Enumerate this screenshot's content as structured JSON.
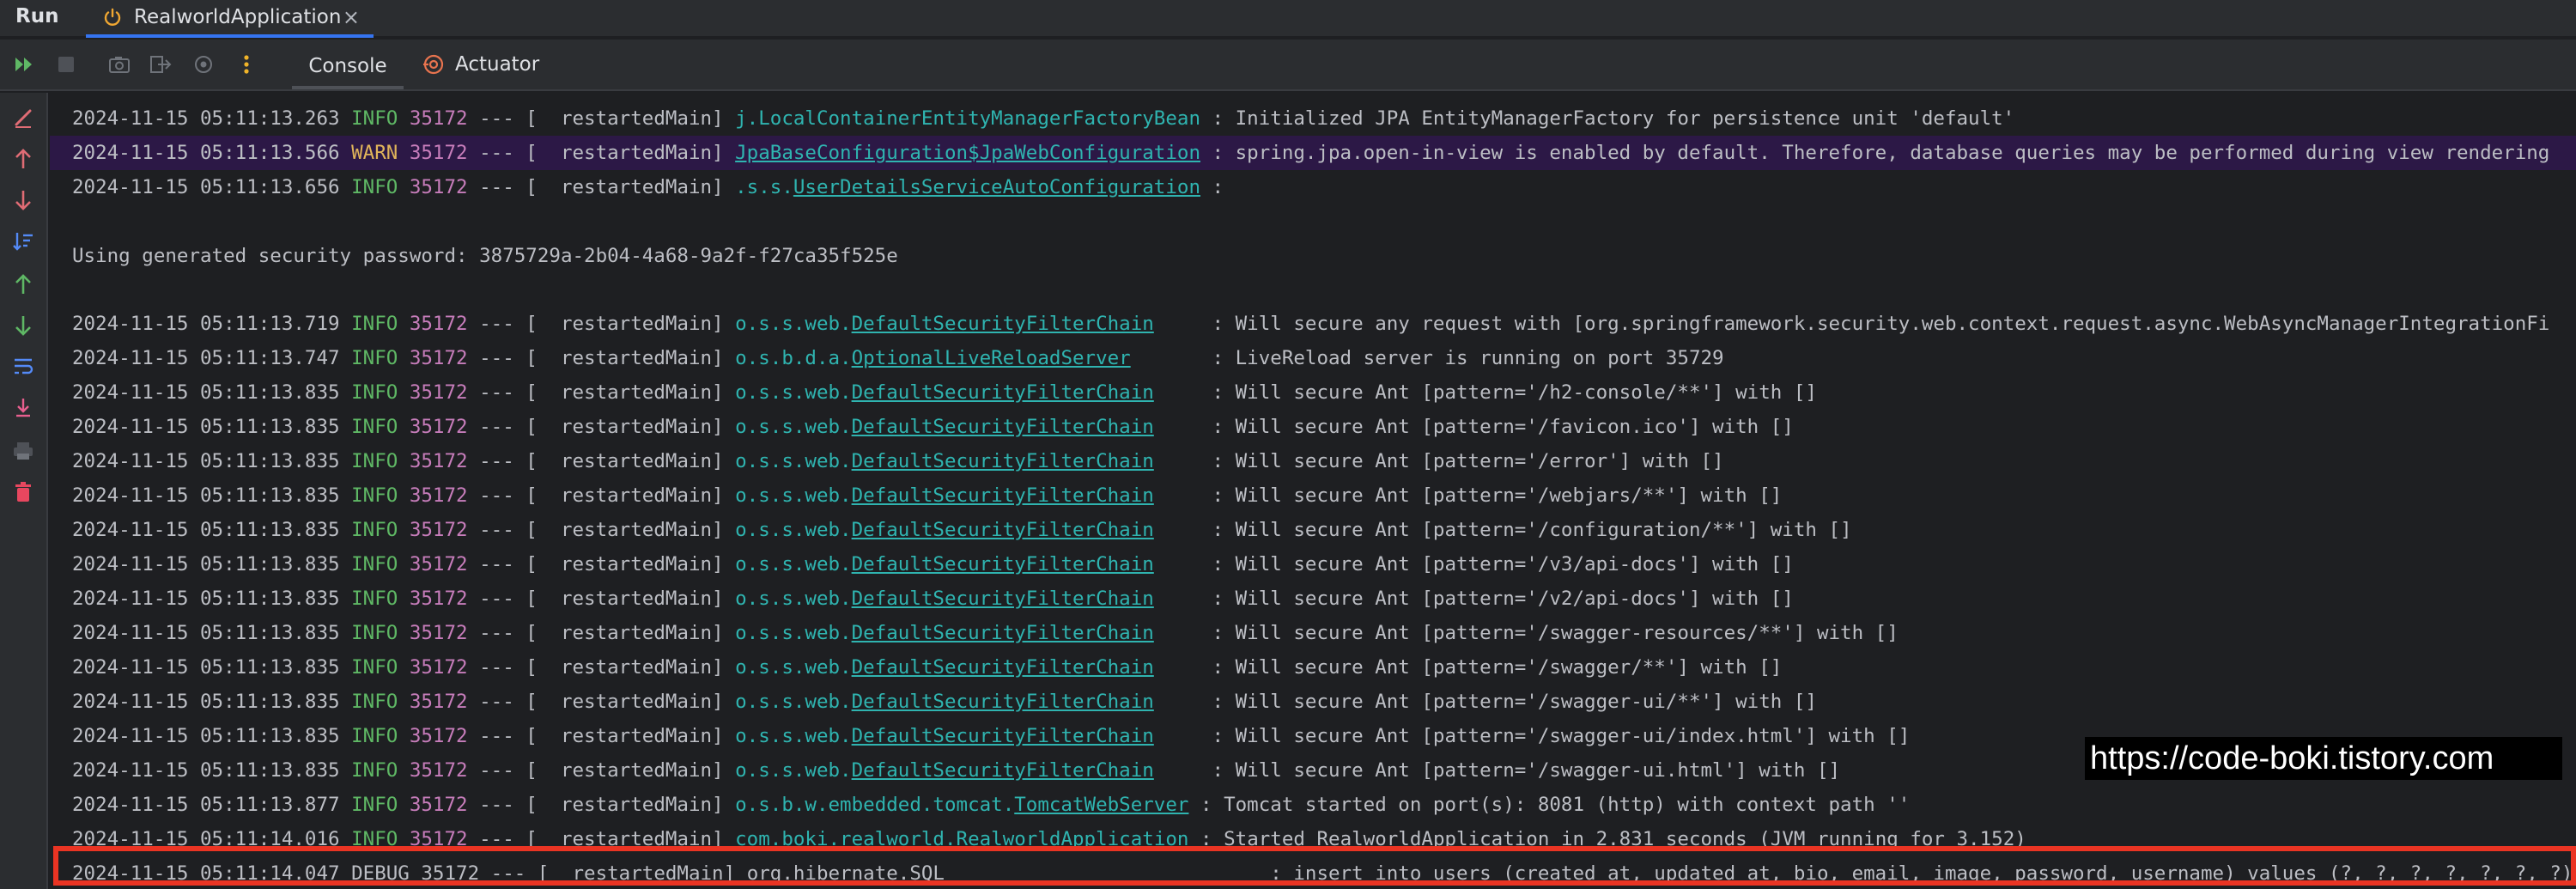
{
  "header": {
    "run_label": "Run",
    "tab_name": "RealworldApplication",
    "tab_icon": "power-icon",
    "close_glyph": "×"
  },
  "toolbar": {
    "icons": [
      "rerun-icon",
      "stop-icon",
      "camera-icon",
      "exit-icon",
      "settings-icon",
      "more-icon"
    ],
    "tabs": [
      {
        "label": "Console",
        "active": true
      },
      {
        "label": "Actuator",
        "icon": "actuator-icon"
      }
    ]
  },
  "gutter": {
    "icons": [
      "pencil-icon",
      "arrow-up-icon",
      "arrow-down-icon",
      "sort-icon",
      "arrow-up-icon",
      "arrow-down-icon",
      "soft-wrap-icon",
      "scroll-to-end-icon",
      "print-icon",
      "trash-icon"
    ]
  },
  "console": {
    "lines": [
      {
        "ts": "2024-11-15 05:11:13.263",
        "level": "INFO",
        "pid": "35172",
        "sep": " --- [  restartedMain] ",
        "logger_pre": "j.LocalContainerEntityManagerFactoryBean",
        "logger_link": "",
        "pad": " ",
        "msg": ": Initialized JPA EntityManagerFactory for persistence unit 'default'"
      },
      {
        "ts": "2024-11-15 05:11:13.566",
        "level": "WARN",
        "pid": "35172",
        "sep": " --- [  restartedMain] ",
        "logger_pre": "",
        "logger_link": "JpaBaseConfiguration$JpaWebConfiguration",
        "pad": " ",
        "msg": ": spring.jpa.open-in-view is enabled by default. Therefore, database queries may be performed during view rendering"
      },
      {
        "ts": "2024-11-15 05:11:13.656",
        "level": "INFO",
        "pid": "35172",
        "sep": " --- [  restartedMain] ",
        "logger_pre": ".s.s.",
        "logger_link": "UserDetailsServiceAutoConfiguration",
        "pad": " ",
        "msg": ":"
      },
      {
        "text": "Using generated security password: 3875729a-2b04-4a68-9a2f-f27ca35f525e"
      },
      {
        "ts": "2024-11-15 05:11:13.719",
        "level": "INFO",
        "pid": "35172",
        "sep": " --- [  restartedMain] ",
        "logger_pre": "o.s.s.web.",
        "logger_link": "DefaultSecurityFilterChain",
        "pad": "     ",
        "msg": ": Will secure any request with [org.springframework.security.web.context.request.async.WebAsyncManagerIntegrationFi"
      },
      {
        "ts": "2024-11-15 05:11:13.747",
        "level": "INFO",
        "pid": "35172",
        "sep": " --- [  restartedMain] ",
        "logger_pre": "o.s.b.d.a.",
        "logger_link": "OptionalLiveReloadServer",
        "pad": "       ",
        "msg": ": LiveReload server is running on port 35729"
      },
      {
        "ts": "2024-11-15 05:11:13.835",
        "level": "INFO",
        "pid": "35172",
        "sep": " --- [  restartedMain] ",
        "logger_pre": "o.s.s.web.",
        "logger_link": "DefaultSecurityFilterChain",
        "pad": "     ",
        "msg": ": Will secure Ant [pattern='/h2-console/**'] with []"
      },
      {
        "ts": "2024-11-15 05:11:13.835",
        "level": "INFO",
        "pid": "35172",
        "sep": " --- [  restartedMain] ",
        "logger_pre": "o.s.s.web.",
        "logger_link": "DefaultSecurityFilterChain",
        "pad": "     ",
        "msg": ": Will secure Ant [pattern='/favicon.ico'] with []"
      },
      {
        "ts": "2024-11-15 05:11:13.835",
        "level": "INFO",
        "pid": "35172",
        "sep": " --- [  restartedMain] ",
        "logger_pre": "o.s.s.web.",
        "logger_link": "DefaultSecurityFilterChain",
        "pad": "     ",
        "msg": ": Will secure Ant [pattern='/error'] with []"
      },
      {
        "ts": "2024-11-15 05:11:13.835",
        "level": "INFO",
        "pid": "35172",
        "sep": " --- [  restartedMain] ",
        "logger_pre": "o.s.s.web.",
        "logger_link": "DefaultSecurityFilterChain",
        "pad": "     ",
        "msg": ": Will secure Ant [pattern='/webjars/**'] with []"
      },
      {
        "ts": "2024-11-15 05:11:13.835",
        "level": "INFO",
        "pid": "35172",
        "sep": " --- [  restartedMain] ",
        "logger_pre": "o.s.s.web.",
        "logger_link": "DefaultSecurityFilterChain",
        "pad": "     ",
        "msg": ": Will secure Ant [pattern='/configuration/**'] with []"
      },
      {
        "ts": "2024-11-15 05:11:13.835",
        "level": "INFO",
        "pid": "35172",
        "sep": " --- [  restartedMain] ",
        "logger_pre": "o.s.s.web.",
        "logger_link": "DefaultSecurityFilterChain",
        "pad": "     ",
        "msg": ": Will secure Ant [pattern='/v3/api-docs'] with []"
      },
      {
        "ts": "2024-11-15 05:11:13.835",
        "level": "INFO",
        "pid": "35172",
        "sep": " --- [  restartedMain] ",
        "logger_pre": "o.s.s.web.",
        "logger_link": "DefaultSecurityFilterChain",
        "pad": "     ",
        "msg": ": Will secure Ant [pattern='/v2/api-docs'] with []"
      },
      {
        "ts": "2024-11-15 05:11:13.835",
        "level": "INFO",
        "pid": "35172",
        "sep": " --- [  restartedMain] ",
        "logger_pre": "o.s.s.web.",
        "logger_link": "DefaultSecurityFilterChain",
        "pad": "     ",
        "msg": ": Will secure Ant [pattern='/swagger-resources/**'] with []"
      },
      {
        "ts": "2024-11-15 05:11:13.835",
        "level": "INFO",
        "pid": "35172",
        "sep": " --- [  restartedMain] ",
        "logger_pre": "o.s.s.web.",
        "logger_link": "DefaultSecurityFilterChain",
        "pad": "     ",
        "msg": ": Will secure Ant [pattern='/swagger/**'] with []"
      },
      {
        "ts": "2024-11-15 05:11:13.835",
        "level": "INFO",
        "pid": "35172",
        "sep": " --- [  restartedMain] ",
        "logger_pre": "o.s.s.web.",
        "logger_link": "DefaultSecurityFilterChain",
        "pad": "     ",
        "msg": ": Will secure Ant [pattern='/swagger-ui/**'] with []"
      },
      {
        "ts": "2024-11-15 05:11:13.835",
        "level": "INFO",
        "pid": "35172",
        "sep": " --- [  restartedMain] ",
        "logger_pre": "o.s.s.web.",
        "logger_link": "DefaultSecurityFilterChain",
        "pad": "     ",
        "msg": ": Will secure Ant [pattern='/swagger-ui/index.html'] with []"
      },
      {
        "ts": "2024-11-15 05:11:13.835",
        "level": "INFO",
        "pid": "35172",
        "sep": " --- [  restartedMain] ",
        "logger_pre": "o.s.s.web.",
        "logger_link": "DefaultSecurityFilterChain",
        "pad": "     ",
        "msg": ": Will secure Ant [pattern='/swagger-ui.html'] with []"
      },
      {
        "ts": "2024-11-15 05:11:13.877",
        "level": "INFO",
        "pid": "35172",
        "sep": " --- [  restartedMain] ",
        "logger_pre": "o.s.b.w.embedded.tomcat.",
        "logger_link": "TomcatWebServer",
        "pad": " ",
        "msg": ": Tomcat started on port(s): 8081 (http) with context path ''"
      },
      {
        "ts": "2024-11-15 05:11:14.016",
        "level": "INFO",
        "pid": "35172",
        "sep": " --- [  restartedMain] ",
        "logger_pre": "com.boki.realworld.",
        "logger_link": "RealworldApplication",
        "pad": " ",
        "msg": ": Started RealworldApplication in 2.831 seconds (JVM running for 3.152)"
      },
      {
        "ts": "2024-11-15 05:11:14.047",
        "level": "DEBUG",
        "pid": "35172",
        "sep": " --- [  restartedMain] ",
        "logger_pre": "org.hibernate.",
        "logger_link": "SQL",
        "pad": "                            ",
        "msg": ": insert into users (created_at, updated_at, bio, email, image, password, username) values (?, ?, ?, ?, ?, ?, ?)"
      }
    ]
  },
  "watermark": "https://code-boki.tistory.com",
  "colors": {
    "highlight_border": "#ea3423",
    "info": "#5fb865",
    "warn": "#e0b45a",
    "pid": "#c77dbb",
    "logger": "#2fb4b0",
    "warn_row_bg": "#2c1846"
  }
}
